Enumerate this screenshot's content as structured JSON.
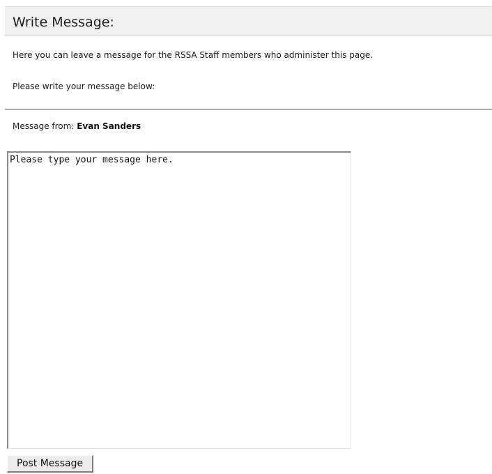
{
  "header": {
    "title": "Write Message:"
  },
  "intro": {
    "text": "Here you can leave a message for the RSSA Staff members who administer this page."
  },
  "instruction": {
    "text": "Please write your message below:"
  },
  "message_from": {
    "label": "Message from:",
    "sender": "Evan Sanders"
  },
  "message_field": {
    "value": "Please type your message here."
  },
  "actions": {
    "post_label": "Post Message"
  }
}
